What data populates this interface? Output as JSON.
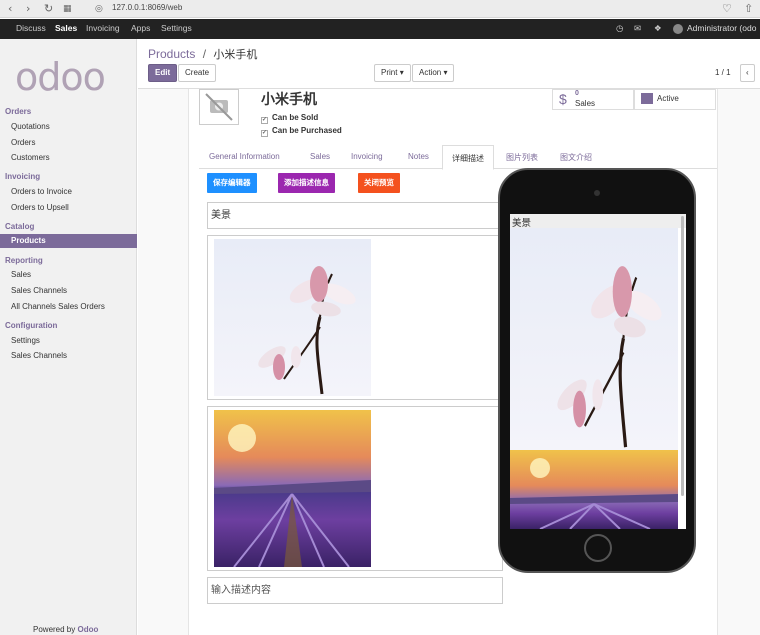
{
  "browser": {
    "url": "127.0.0.1:8069/web"
  },
  "topnav": {
    "items": [
      "Discuss",
      "Sales",
      "Invoicing",
      "Apps",
      "Settings"
    ],
    "active": "Sales",
    "user": "Administrator (odo"
  },
  "sidebar": {
    "logo": "odoo",
    "sections": [
      {
        "title": "Orders",
        "items": [
          "Quotations",
          "Orders",
          "Customers"
        ]
      },
      {
        "title": "Invoicing",
        "items": [
          "Orders to Invoice",
          "Orders to Upsell"
        ]
      },
      {
        "title": "Catalog",
        "items": [
          "Products"
        ]
      },
      {
        "title": "Reporting",
        "items": [
          "Sales",
          "Sales Channels",
          "All Channels Sales Orders"
        ]
      },
      {
        "title": "Configuration",
        "items": [
          "Settings",
          "Sales Channels"
        ]
      }
    ],
    "active_item": "Products",
    "powered_prefix": "Powered by",
    "powered_brand": "Odoo"
  },
  "control_panel": {
    "breadcrumb_parent": "Products",
    "breadcrumb_sep": "/",
    "breadcrumb_current": "小米手机",
    "edit_label": "Edit",
    "create_label": "Create",
    "print_label": "Print",
    "action_label": "Action",
    "pager": "1 / 1"
  },
  "product": {
    "name": "小米手机",
    "can_be_sold": "Can be Sold",
    "can_be_purchased": "Can be Purchased",
    "sales_count": "0",
    "sales_label": "Sales",
    "active_label": "Active"
  },
  "tabs": [
    "General Information",
    "Sales",
    "Invoicing",
    "Notes",
    "详细描述",
    "图片列表",
    "图文介绍"
  ],
  "active_tab": "详细描述",
  "actions": {
    "save_editor": "保存编辑器",
    "add_desc": "添加描述信息",
    "close_preview": "关闭预览"
  },
  "blocks": {
    "title_text": "美景",
    "input_placeholder": "输入描述内容"
  },
  "phone_preview": {
    "title": "美景"
  },
  "colors": {
    "brand": "#7c6b9a",
    "blue_btn": "#1e90ff",
    "purple_btn": "#9b27af",
    "red_btn": "#f4511e"
  }
}
